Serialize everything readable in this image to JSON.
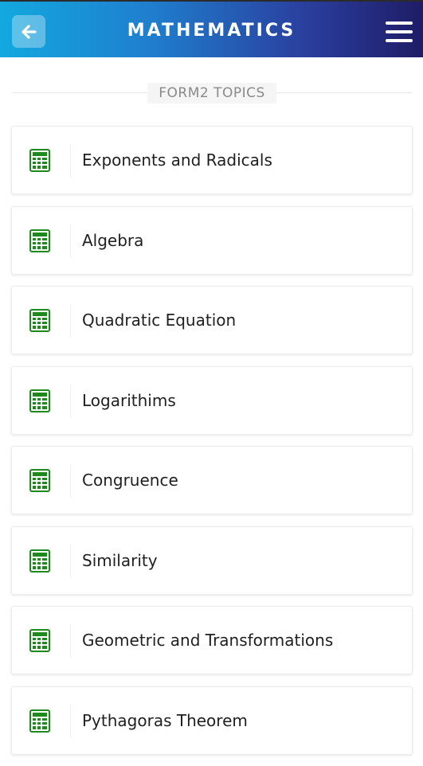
{
  "header": {
    "title": "MATHEMATICS",
    "back_icon": "arrow-left-icon",
    "menu_icon": "hamburger-menu-icon",
    "gradient_colors": [
      "#13a8df",
      "#2a3f9e",
      "#1f1c67"
    ]
  },
  "section": {
    "label": "FORM2 TOPICS"
  },
  "topics": [
    {
      "label": "Exponents and Radicals",
      "icon": "calculator-icon"
    },
    {
      "label": "Algebra",
      "icon": "calculator-icon"
    },
    {
      "label": "Quadratic Equation",
      "icon": "calculator-icon"
    },
    {
      "label": "Logarithims",
      "icon": "calculator-icon"
    },
    {
      "label": "Congruence",
      "icon": "calculator-icon"
    },
    {
      "label": "Similarity",
      "icon": "calculator-icon"
    },
    {
      "label": "Geometric and Transformations",
      "icon": "calculator-icon"
    },
    {
      "label": "Pythagoras Theorem",
      "icon": "calculator-icon"
    }
  ],
  "icon_color": "#1e8a1e"
}
